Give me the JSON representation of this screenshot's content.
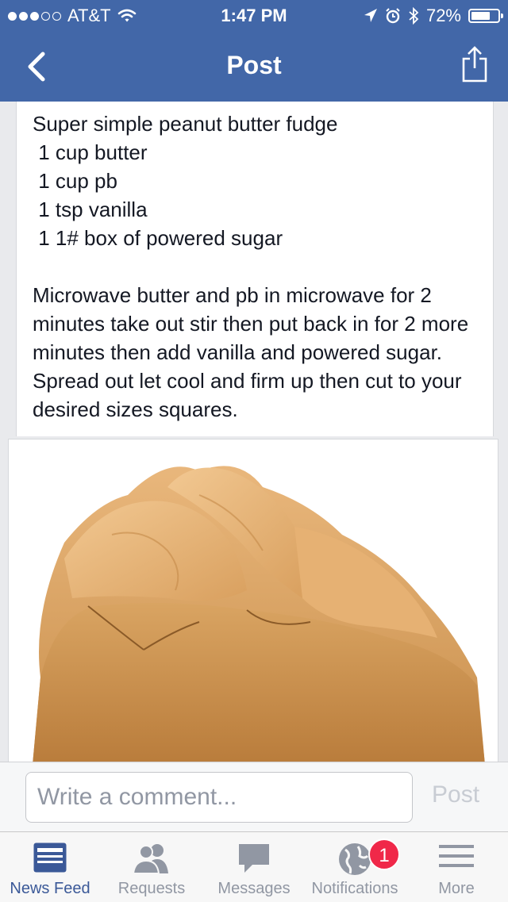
{
  "status_bar": {
    "carrier": "AT&T",
    "time": "1:47 PM",
    "battery": "72%",
    "battery_level": 0.72,
    "signal_bars_filled": 3,
    "signal_bars_total": 5,
    "icons": [
      "wifi-icon",
      "location-arrow-icon",
      "alarm-icon",
      "bluetooth-icon",
      "battery-icon"
    ]
  },
  "nav": {
    "title": "Post",
    "back_icon": "chevron-left-icon",
    "share_icon": "share-icon"
  },
  "post": {
    "lines": [
      "Super simple peanut butter fudge",
      " 1 cup butter",
      " 1 cup pb",
      " 1 tsp vanilla",
      " 1 1# box of powered sugar"
    ],
    "instructions": " Microwave butter and pb in microwave for 2 minutes take out stir then put back in for 2 more minutes then add vanilla and powered sugar. Spread out let cool and firm up then cut to your desired sizes squares.",
    "photo_subject": "peanut-butter-fudge-photo"
  },
  "comment": {
    "placeholder": "Write a comment...",
    "post_label": "Post"
  },
  "tabs": [
    {
      "label": "News Feed",
      "icon": "news-feed-icon",
      "active": true
    },
    {
      "label": "Requests",
      "icon": "friend-requests-icon",
      "active": false
    },
    {
      "label": "Messages",
      "icon": "messages-icon",
      "active": false
    },
    {
      "label": "Notifications",
      "icon": "globe-icon",
      "active": false,
      "badge": "1"
    },
    {
      "label": "More",
      "icon": "menu-icon",
      "active": false
    }
  ],
  "colors": {
    "brand_blue": "#4267a8",
    "tab_active": "#3b5998",
    "tab_inactive": "#9197a3",
    "badge": "#f02849"
  }
}
